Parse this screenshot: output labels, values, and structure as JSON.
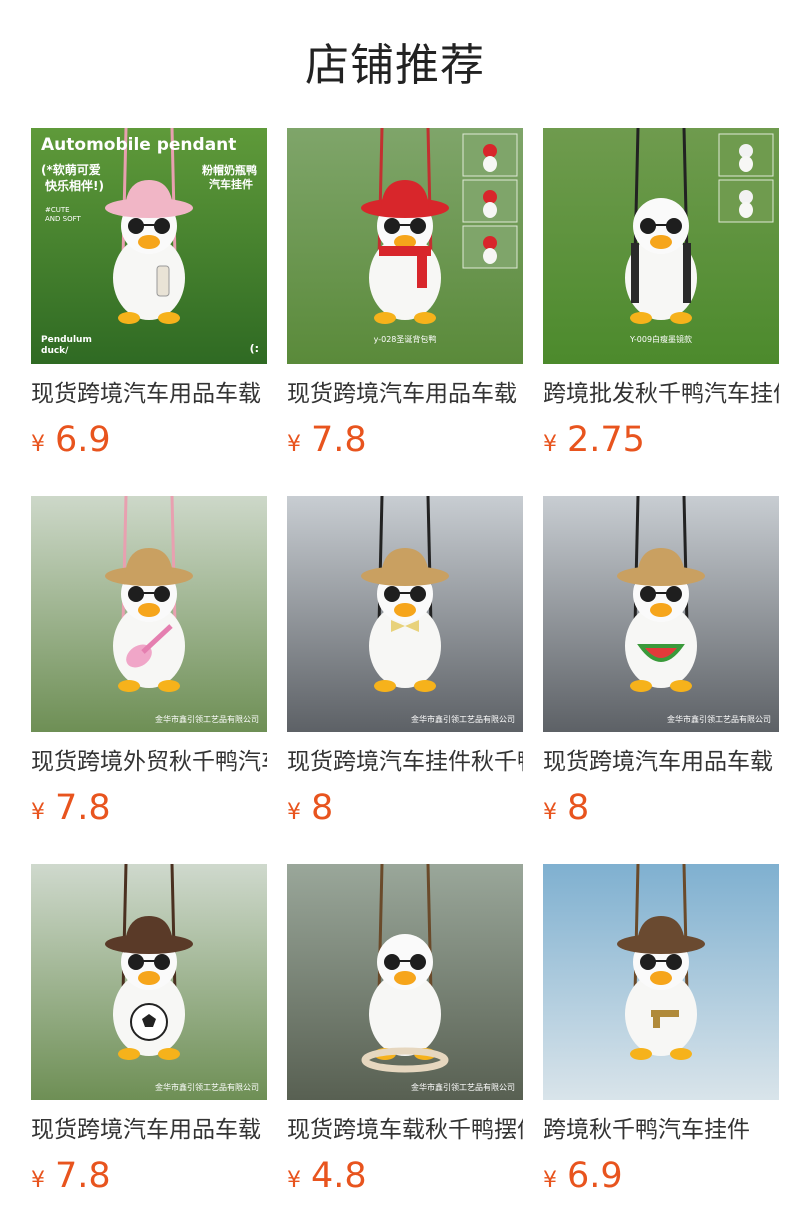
{
  "header": {
    "title": "店铺推荐"
  },
  "products": [
    {
      "title": "现货跨境汽车用品车载",
      "currency": "¥",
      "price": "6.9",
      "image": {
        "bg_top": "#5f9a3a",
        "bg_bottom": "#2f6a23",
        "hat_color": "#f1b6c6",
        "accessory": "bottle",
        "string_color": "#e8a0b0",
        "overlay_title": "Automobile pendant",
        "overlay_badge_line1": "(*软萌可爱",
        "overlay_badge_line2": "快乐相伴!)",
        "overlay_side_line1": "粉帽奶瓶鸭",
        "overlay_side_line2": "汽车挂件",
        "overlay_tag_line1": "#CUTE",
        "overlay_tag_line2": "AND SOFT",
        "overlay_bottom_line1": "Pendulum",
        "overlay_bottom_line2": "duck/",
        "overlay_corner": "(:",
        "caption": ""
      }
    },
    {
      "title": "现货跨境汽车用品车载",
      "currency": "¥",
      "price": "7.8",
      "image": {
        "bg_top": "#7fa56a",
        "bg_bottom": "#5a8a3a",
        "hat_color": "#d8262b",
        "accessory": "scarf",
        "string_color": "#c23030",
        "caption": "y-028圣诞背包鸭",
        "has_insets": true
      }
    },
    {
      "title": "跨境批发秋千鸭汽车挂件",
      "currency": "¥",
      "price": "2.75",
      "image": {
        "bg_top": "#6f9b4e",
        "bg_bottom": "#4c8a2c",
        "hat_color": "",
        "accessory": "glasses",
        "string_color": "#222222",
        "caption": "Y-009白瘦墨镜款",
        "has_insets": true
      }
    },
    {
      "title": "现货跨境外贸秋千鸭汽车",
      "currency": "¥",
      "price": "7.8",
      "image": {
        "bg_top": "#cdd8c9",
        "bg_bottom": "#6e8f55",
        "hat_color": "#c9a061",
        "accessory": "guitar",
        "string_color": "#e8a0b0",
        "caption": "金华市鑫引领工艺品有限公司"
      }
    },
    {
      "title": "现货跨境汽车挂件秋千鸭",
      "currency": "¥",
      "price": "8",
      "image": {
        "bg_top": "#c8cdd2",
        "bg_bottom": "#5d6166",
        "hat_color": "#c9a061",
        "accessory": "bowtie",
        "string_color": "#222222",
        "caption": "金华市鑫引领工艺品有限公司"
      }
    },
    {
      "title": "现货跨境汽车用品车载",
      "currency": "¥",
      "price": "8",
      "image": {
        "bg_top": "#c8cdd2",
        "bg_bottom": "#5d6166",
        "hat_color": "#c9a061",
        "accessory": "watermelon",
        "string_color": "#222222",
        "caption": "金华市鑫引领工艺品有限公司"
      }
    },
    {
      "title": "现货跨境汽车用品车载",
      "currency": "¥",
      "price": "7.8",
      "image": {
        "bg_top": "#cfd9cd",
        "bg_bottom": "#6e8f55",
        "hat_color": "#5a3a28",
        "accessory": "football",
        "string_color": "#4a3020",
        "caption": "金华市鑫引领工艺品有限公司"
      }
    },
    {
      "title": "现货跨境车载秋千鸭摆件",
      "currency": "¥",
      "price": "4.8",
      "image": {
        "bg_top": "#9aa79a",
        "bg_bottom": "#586052",
        "hat_color": "",
        "accessory": "swing",
        "string_color": "#6a4a2a",
        "caption": "金华市鑫引领工艺品有限公司"
      }
    },
    {
      "title": "跨境秋千鸭汽车挂件",
      "currency": "¥",
      "price": "6.9",
      "image": {
        "bg_top": "#7fb0d0",
        "bg_bottom": "#d9e4ea",
        "hat_color": "#6a4a30",
        "accessory": "gun",
        "string_color": "#6a4a2a",
        "caption": ""
      }
    }
  ]
}
